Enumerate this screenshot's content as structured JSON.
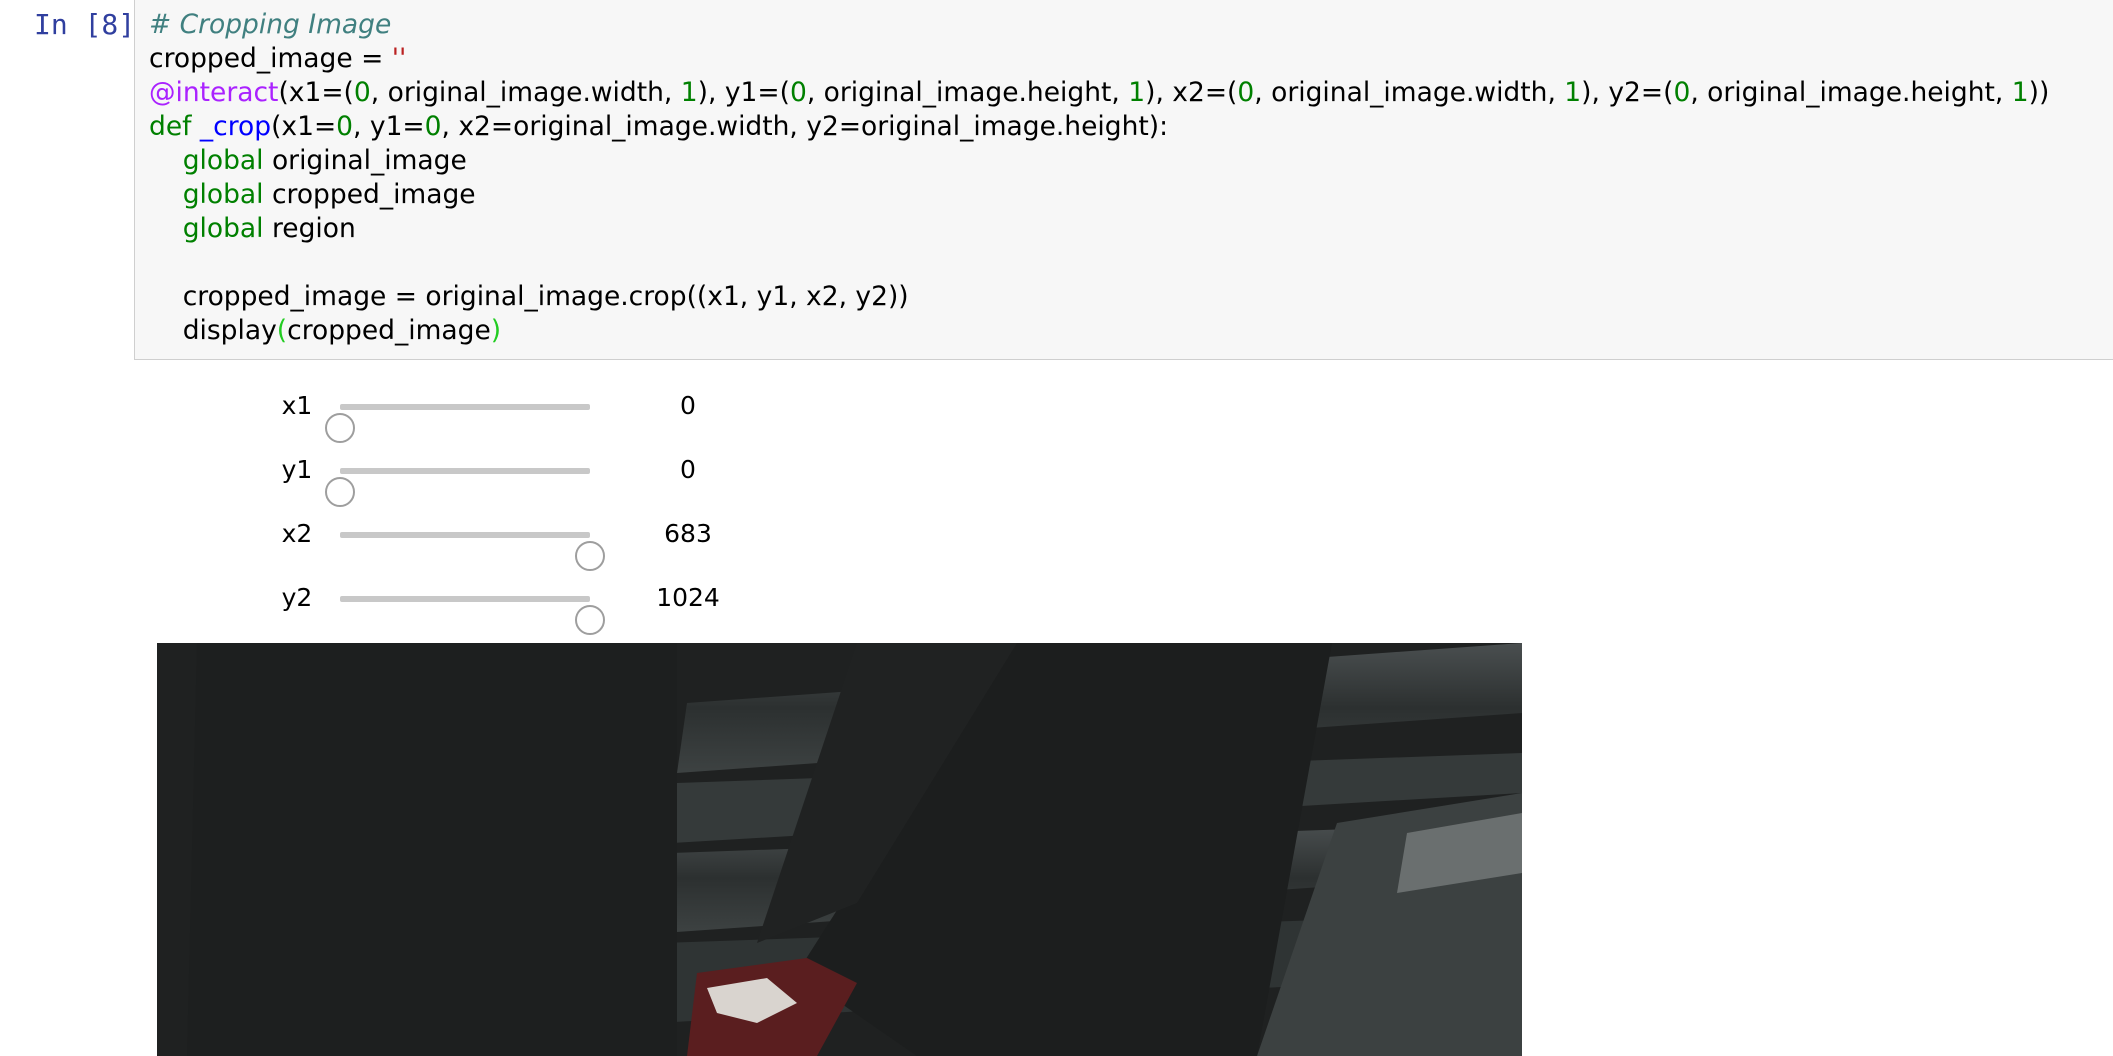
{
  "cell": {
    "prompt": "In [8]:",
    "code_lines": [
      [
        {
          "t": "# Cropping Image",
          "c": "comment"
        }
      ],
      [
        {
          "t": "cropped_image = ",
          "c": ""
        },
        {
          "t": "''",
          "c": "str"
        }
      ],
      [
        {
          "t": "@interact",
          "c": "dec"
        },
        {
          "t": "(x1=(",
          "c": ""
        },
        {
          "t": "0",
          "c": "num"
        },
        {
          "t": ", original_image.width, ",
          "c": ""
        },
        {
          "t": "1",
          "c": "num"
        },
        {
          "t": "), y1=(",
          "c": ""
        },
        {
          "t": "0",
          "c": "num"
        },
        {
          "t": ", original_image.height, ",
          "c": ""
        },
        {
          "t": "1",
          "c": "num"
        },
        {
          "t": "), x2=(",
          "c": ""
        },
        {
          "t": "0",
          "c": "num"
        },
        {
          "t": ", original_image.width, ",
          "c": ""
        },
        {
          "t": "1",
          "c": "num"
        },
        {
          "t": "), y2=(",
          "c": ""
        },
        {
          "t": "0",
          "c": "num"
        },
        {
          "t": ", original_image.height, ",
          "c": ""
        },
        {
          "t": "1",
          "c": "num"
        },
        {
          "t": "))",
          "c": ""
        }
      ],
      [
        {
          "t": "def",
          "c": "kw"
        },
        {
          "t": " ",
          "c": ""
        },
        {
          "t": "_crop",
          "c": "fn"
        },
        {
          "t": "(x1=",
          "c": ""
        },
        {
          "t": "0",
          "c": "num"
        },
        {
          "t": ", y1=",
          "c": ""
        },
        {
          "t": "0",
          "c": "num"
        },
        {
          "t": ", x2=original_image.width, y2=original_image.height):",
          "c": ""
        }
      ],
      [
        {
          "t": "    ",
          "c": ""
        },
        {
          "t": "global",
          "c": "kw"
        },
        {
          "t": " original_image",
          "c": ""
        }
      ],
      [
        {
          "t": "    ",
          "c": ""
        },
        {
          "t": "global",
          "c": "kw"
        },
        {
          "t": " cropped_image",
          "c": ""
        }
      ],
      [
        {
          "t": "    ",
          "c": ""
        },
        {
          "t": "global",
          "c": "kw"
        },
        {
          "t": " region",
          "c": ""
        }
      ],
      [
        {
          "t": "",
          "c": ""
        }
      ],
      [
        {
          "t": "    cropped_image = original_image.crop((x1, y1, x2, y2))",
          "c": ""
        }
      ],
      [
        {
          "t": "    display",
          "c": ""
        },
        {
          "t": "(",
          "c": "paren"
        },
        {
          "t": "cropped_image",
          "c": ""
        },
        {
          "t": ")",
          "c": "paren"
        }
      ]
    ]
  },
  "sliders": [
    {
      "label": "x1",
      "value": "0",
      "fraction": 0.0
    },
    {
      "label": "y1",
      "value": "0",
      "fraction": 0.0
    },
    {
      "label": "x2",
      "value": "683",
      "fraction": 1.0
    },
    {
      "label": "y2",
      "value": "1024",
      "fraction": 1.0
    }
  ],
  "output": {
    "image_description_icon": "cropped-photo-image"
  }
}
